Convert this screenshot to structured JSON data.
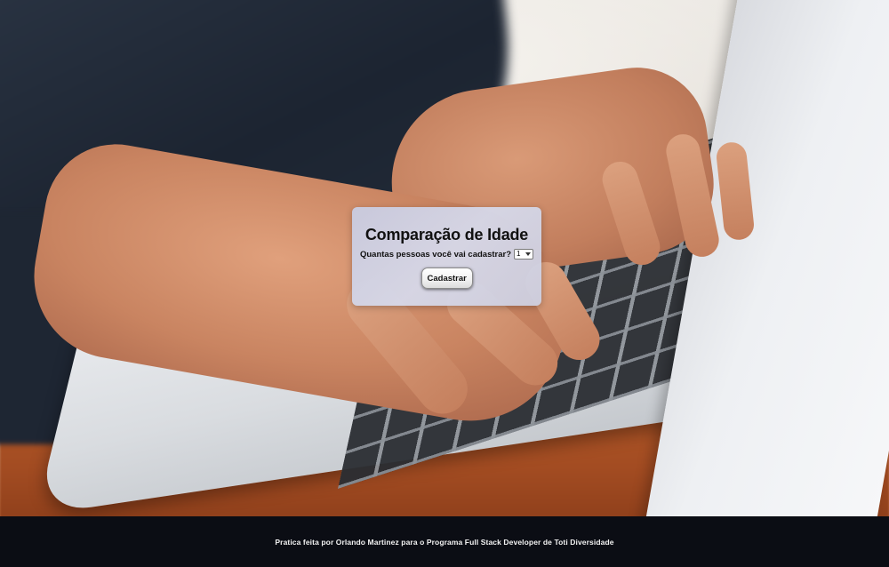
{
  "background": {
    "image": "hands-typing-on-laptop-photo"
  },
  "form": {
    "title": "Comparação de Idade",
    "question_label": "Quantas pessoas você vai cadastrar?",
    "people_count_selected": "1",
    "submit_label": "Cadastrar"
  },
  "footer": {
    "text": "Pratica feita por Orlando Martinez para o Programa Full Stack Developer de Toti Diversidade"
  },
  "colors": {
    "card_background": "#ccd0e6",
    "footer_background": "#0b0d14",
    "footer_text": "#f2f2f2"
  }
}
